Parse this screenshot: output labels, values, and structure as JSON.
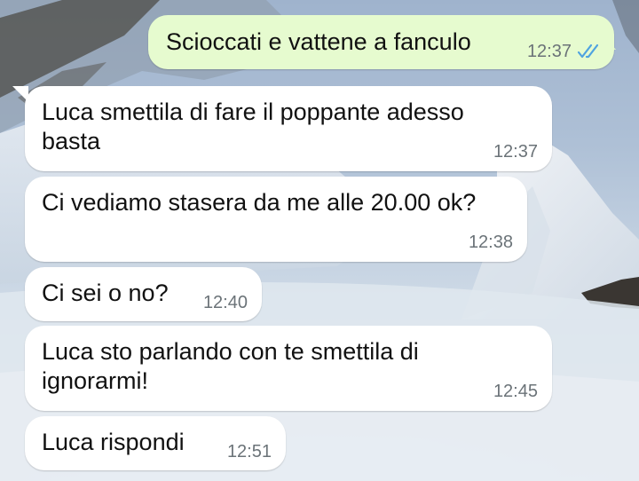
{
  "conversation": {
    "messages": [
      {
        "direction": "outgoing",
        "text": "Scioccati e vattene a fanculo",
        "time": "12:37",
        "status_icon": "double-check-read-icon"
      },
      {
        "direction": "incoming",
        "lines": [
          "Luca smettila di fare il poppante adesso",
          "basta"
        ],
        "time": "12:37"
      },
      {
        "direction": "incoming",
        "text": "Ci vediamo stasera da me alle 20.00 ok?",
        "time": "12:38"
      },
      {
        "direction": "incoming",
        "text": "Ci sei o no?",
        "time": "12:40"
      },
      {
        "direction": "incoming",
        "lines": [
          "Luca sto parlando con te smettila di",
          "ignorarmi!"
        ],
        "time": "12:45"
      },
      {
        "direction": "incoming",
        "text": "Luca rispondi",
        "time": "12:51"
      }
    ]
  },
  "colors": {
    "incoming_bubble": "#ffffff",
    "outgoing_bubble": "#e6fbcf",
    "timestamp": "#6b7378",
    "read_checkmarks": "#4fa3e0"
  },
  "background": {
    "description_icon": "snowy-mountain-wallpaper"
  }
}
